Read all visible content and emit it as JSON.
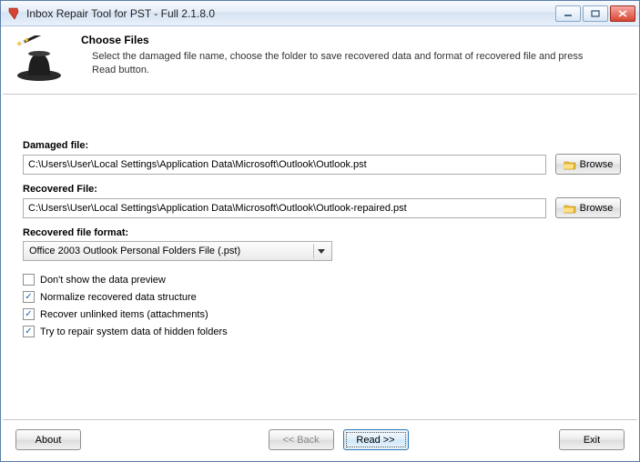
{
  "window": {
    "title": "Inbox Repair Tool for PST - Full 2.1.8.0"
  },
  "header": {
    "title": "Choose Files",
    "subtitle": "Select the damaged file name, choose the folder to save recovered data and format of recovered file and press Read button."
  },
  "damaged": {
    "label": "Damaged file:",
    "value": "C:\\Users\\User\\Local Settings\\Application Data\\Microsoft\\Outlook\\Outlook.pst",
    "browse": "Browse"
  },
  "recovered": {
    "label": "Recovered File:",
    "value": "C:\\Users\\User\\Local Settings\\Application Data\\Microsoft\\Outlook\\Outlook-repaired.pst",
    "browse": "Browse"
  },
  "format": {
    "label": "Recovered file format:",
    "selected": "Office 2003 Outlook Personal Folders File (.pst)"
  },
  "checks": {
    "preview": "Don't show the data preview",
    "normalize": "Normalize recovered data structure",
    "unlinked": "Recover unlinked items (attachments)",
    "system": "Try to repair system data of hidden folders"
  },
  "footer": {
    "about": "About",
    "back": "<< Back",
    "read": "Read >>",
    "exit": "Exit"
  }
}
